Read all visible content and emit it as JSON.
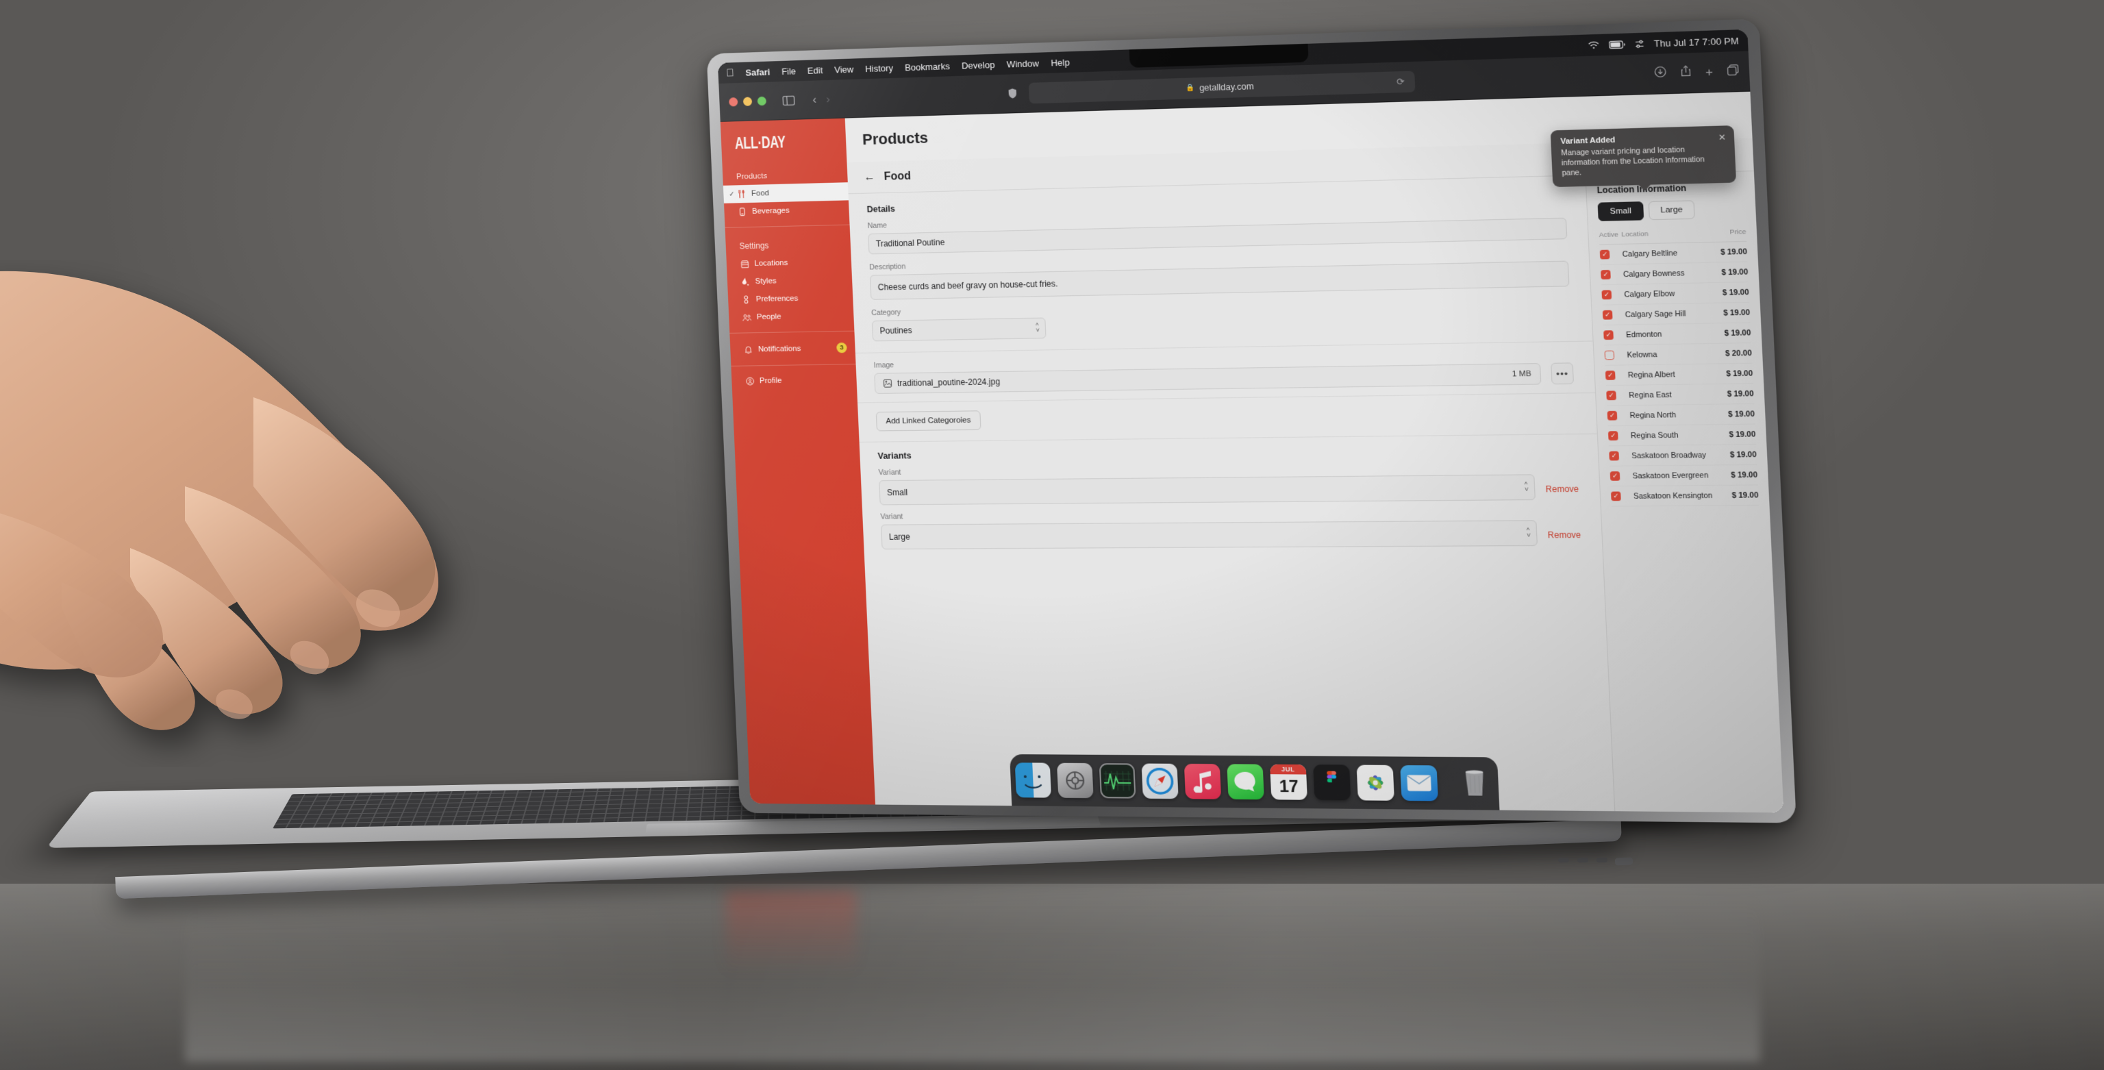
{
  "menubar": {
    "apple": "",
    "items": [
      "Safari",
      "File",
      "Edit",
      "View",
      "History",
      "Bookmarks",
      "Develop",
      "Window",
      "Help"
    ],
    "status": {
      "wifi": "wifi-icon",
      "battery": "battery-icon",
      "control": "control-center-icon",
      "clock": "Thu Jul 17  7:00 PM"
    }
  },
  "browser": {
    "sidebar_toggle": "sidebar-toggle-icon",
    "back": "‹",
    "forward": "›",
    "shield": "privacy-shield-icon",
    "lock": "🔒",
    "url": "getallday.com",
    "reload": "⟳",
    "downloads": "downloads-icon",
    "share": "share-icon",
    "new_tab": "+",
    "tabs": "tab-overview-icon"
  },
  "brand": {
    "logo": "ALL·DAY",
    "red": "#d0402f",
    "badge_yellow": "#e9ca3c"
  },
  "sidebar": {
    "sections": [
      {
        "header": "Products",
        "items": [
          {
            "label": "Food",
            "icon": "utensils-icon",
            "active": true,
            "check": "✓"
          },
          {
            "label": "Beverages",
            "icon": "cup-icon",
            "active": false
          }
        ]
      },
      {
        "header": "Settings",
        "items": [
          {
            "label": "Locations",
            "icon": "store-icon",
            "active": false
          },
          {
            "label": "Styles",
            "icon": "paint-icon",
            "active": false
          },
          {
            "label": "Preferences",
            "icon": "sliders-icon",
            "active": false
          },
          {
            "label": "People",
            "icon": "people-icon",
            "active": false
          }
        ]
      }
    ],
    "notifications": {
      "label": "Notifications",
      "icon": "bell-icon",
      "badge": "3"
    },
    "profile": {
      "label": "Profile",
      "icon": "profile-icon"
    }
  },
  "page": {
    "title": "Products",
    "back_icon": "←",
    "subtitle": "Food"
  },
  "details": {
    "heading": "Details",
    "name_label": "Name",
    "name_value": "Traditional Poutine",
    "description_label": "Description",
    "description_value": "Cheese curds and beef gravy on house-cut fries.",
    "category_label": "Category",
    "category_value": "Poutines"
  },
  "image": {
    "label": "Image",
    "icon": "image-file-icon",
    "filename": "traditional_poutine-2024.jpg",
    "size": "1 MB",
    "menu": "•••"
  },
  "linked": {
    "button": "Add Linked Categoroies"
  },
  "variants": {
    "heading": "Variants",
    "rows": [
      {
        "label": "Variant",
        "value": "Small",
        "remove": "Remove"
      },
      {
        "label": "Variant",
        "value": "Large",
        "remove": "Remove"
      }
    ]
  },
  "location_pane": {
    "heading": "Location Information",
    "segments": [
      {
        "label": "Small",
        "selected": true
      },
      {
        "label": "Large",
        "selected": false
      }
    ],
    "columns": {
      "active": "Active",
      "location": "Location",
      "price": "Price"
    },
    "rows": [
      {
        "active": true,
        "location": "Calgary Beltline",
        "price": "$ 19.00"
      },
      {
        "active": true,
        "location": "Calgary Bowness",
        "price": "$ 19.00"
      },
      {
        "active": true,
        "location": "Calgary Elbow",
        "price": "$ 19.00"
      },
      {
        "active": true,
        "location": "Calgary Sage Hill",
        "price": "$ 19.00"
      },
      {
        "active": true,
        "location": "Edmonton",
        "price": "$ 19.00"
      },
      {
        "active": false,
        "location": "Kelowna",
        "price": "$ 20.00"
      },
      {
        "active": true,
        "location": "Regina Albert",
        "price": "$ 19.00"
      },
      {
        "active": true,
        "location": "Regina East",
        "price": "$ 19.00"
      },
      {
        "active": true,
        "location": "Regina North",
        "price": "$ 19.00"
      },
      {
        "active": true,
        "location": "Regina South",
        "price": "$ 19.00"
      },
      {
        "active": true,
        "location": "Saskatoon Broadway",
        "price": "$ 19.00"
      },
      {
        "active": true,
        "location": "Saskatoon Evergreen",
        "price": "$ 19.00"
      },
      {
        "active": true,
        "location": "Saskatoon Kensington",
        "price": "$ 19.00"
      }
    ]
  },
  "toast": {
    "title": "Variant Added",
    "body": "Manage variant pricing and location information from the Location Information pane.",
    "close": "✕"
  },
  "dock": {
    "apps": [
      {
        "name": "finder-icon",
        "label": "Finder"
      },
      {
        "name": "system-settings-icon",
        "label": "System Settings"
      },
      {
        "name": "activity-monitor-icon",
        "label": "Activity Monitor"
      },
      {
        "name": "safari-icon",
        "label": "Safari"
      },
      {
        "name": "music-icon",
        "label": "Music"
      },
      {
        "name": "messages-icon",
        "label": "Messages"
      },
      {
        "name": "calendar-icon",
        "label": "Calendar",
        "month": "JUL",
        "day": "17"
      },
      {
        "name": "figma-icon",
        "label": "Figma"
      },
      {
        "name": "photos-icon",
        "label": "Photos"
      },
      {
        "name": "mail-icon",
        "label": "Mail"
      },
      {
        "name": "trash-icon",
        "label": "Trash"
      }
    ]
  }
}
